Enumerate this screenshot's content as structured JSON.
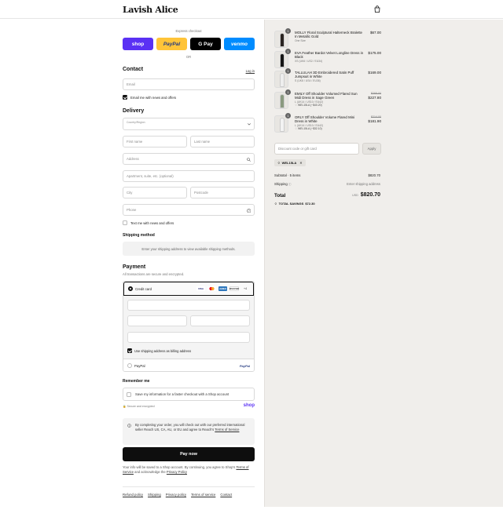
{
  "header": {
    "logo": "Lavish Alice",
    "bag_icon": "shopping-bag-icon"
  },
  "express": {
    "label": "Express checkout",
    "buttons": [
      {
        "label": "shop",
        "bg": "#5a31f4",
        "fg": "#ffffff"
      },
      {
        "label": "PayPal",
        "bg": "#ffc439",
        "fg": "#253b80"
      },
      {
        "label": "G Pay",
        "bg": "#000000",
        "fg": "#ffffff"
      },
      {
        "label": "venmo",
        "bg": "#008cff",
        "fg": "#ffffff"
      }
    ],
    "or": "OR"
  },
  "contact": {
    "title": "Contact",
    "login": "Log in",
    "email_placeholder": "Email",
    "news_label": "Email me with news and offers"
  },
  "delivery": {
    "title": "Delivery",
    "country_label": "Country/Region",
    "first_name": "First name",
    "last_name": "Last name",
    "address": "Address",
    "apartment": "Apartment, suite, etc. (optional)",
    "city": "City",
    "postcode": "Postcode",
    "phone": "Phone",
    "text_label": "Text me with news and offers"
  },
  "shipping_method": {
    "title": "Shipping method",
    "message": "Enter your shipping address to view available shipping methods."
  },
  "payment": {
    "title": "Payment",
    "subtitle": "All transactions are secure and encrypted.",
    "credit_card": "Credit card",
    "card_logos": [
      "VISA",
      "MC",
      "AMEX",
      "DISCOVER"
    ],
    "more": "+4",
    "billing_label": "Use shipping address as billing address",
    "paypal": "PayPal",
    "paypal_logo": "PayPal"
  },
  "remember": {
    "title": "Remember me",
    "save_label": "Save my information for a faster checkout with a Shop account",
    "secure": "Secure and encrypted",
    "shop": "shop"
  },
  "notice": {
    "text": "By completing your order, you will check out with our preferred international seller Reach US, CA, AU, or EU and agree to Reach's",
    "link": "Terms of Service"
  },
  "pay_now": "Pay now",
  "legal": {
    "text": "Your info will be saved to a Shop account. By continuing, you agree to Shop's",
    "terms": "Terms of Service",
    "and": "and acknowledge the",
    "privacy": "Privacy Policy"
  },
  "footer": [
    "Refund policy",
    "Shipping",
    "Privacy policy",
    "Terms of service",
    "Contact"
  ],
  "order": {
    "items": [
      {
        "qty": "1",
        "name": "MOLLY Floral Sculptural Halterneck Bralette In Metallic Gold",
        "variant": "One Size",
        "price": "$67.00",
        "discount": "",
        "compare": "",
        "color": "#2a2522"
      },
      {
        "qty": "1",
        "name": "EVA Feather Bardot Velvet Longline Dress in Black",
        "variant": "XS (UK6 / US2 / EU34)",
        "price": "$175.00",
        "discount": "",
        "compare": "",
        "color": "#161616"
      },
      {
        "qty": "1",
        "name": "TALLULAH 3D Embroidered Satin Puff Jumpsuit in White",
        "variant": "S (UK8 / US4 / EU36)",
        "price": "$169.00",
        "discount": "",
        "compare": "",
        "color": "#eeeeee"
      },
      {
        "qty": "1",
        "name": "EMILY Off Shoulder Volumed Flared Sun Midi Dress in Sage Green",
        "variant": "L (UK14 / US10 / EU42)",
        "price": "$227.80",
        "discount": "WEL15LA (−$40.20)",
        "compare": "$268.00",
        "color": "#8a9a80"
      },
      {
        "qty": "1",
        "name": "ORLY Off Shoulder Volume Flared Mini Dress in White",
        "variant": "L (UK14 / US10 / EU42)",
        "price": "$181.90",
        "discount": "WEL15LA (−$32.10)",
        "compare": "$214.00",
        "color": "#f3f3f3"
      }
    ],
    "discount_placeholder": "Discount code or gift card",
    "apply": "Apply",
    "code_tag": "WEL15LA",
    "subtotal_label": "Subtotal · 5 items",
    "subtotal": "$820.70",
    "shipping_label": "Shipping",
    "shipping_value": "Enter shipping address",
    "total_label": "Total",
    "currency": "USD",
    "total": "$820.70",
    "savings_label": "TOTAL SAVINGS",
    "savings": "$72.30"
  },
  "colors": {
    "accent": "#111111",
    "panel": "#f0eeeb"
  }
}
